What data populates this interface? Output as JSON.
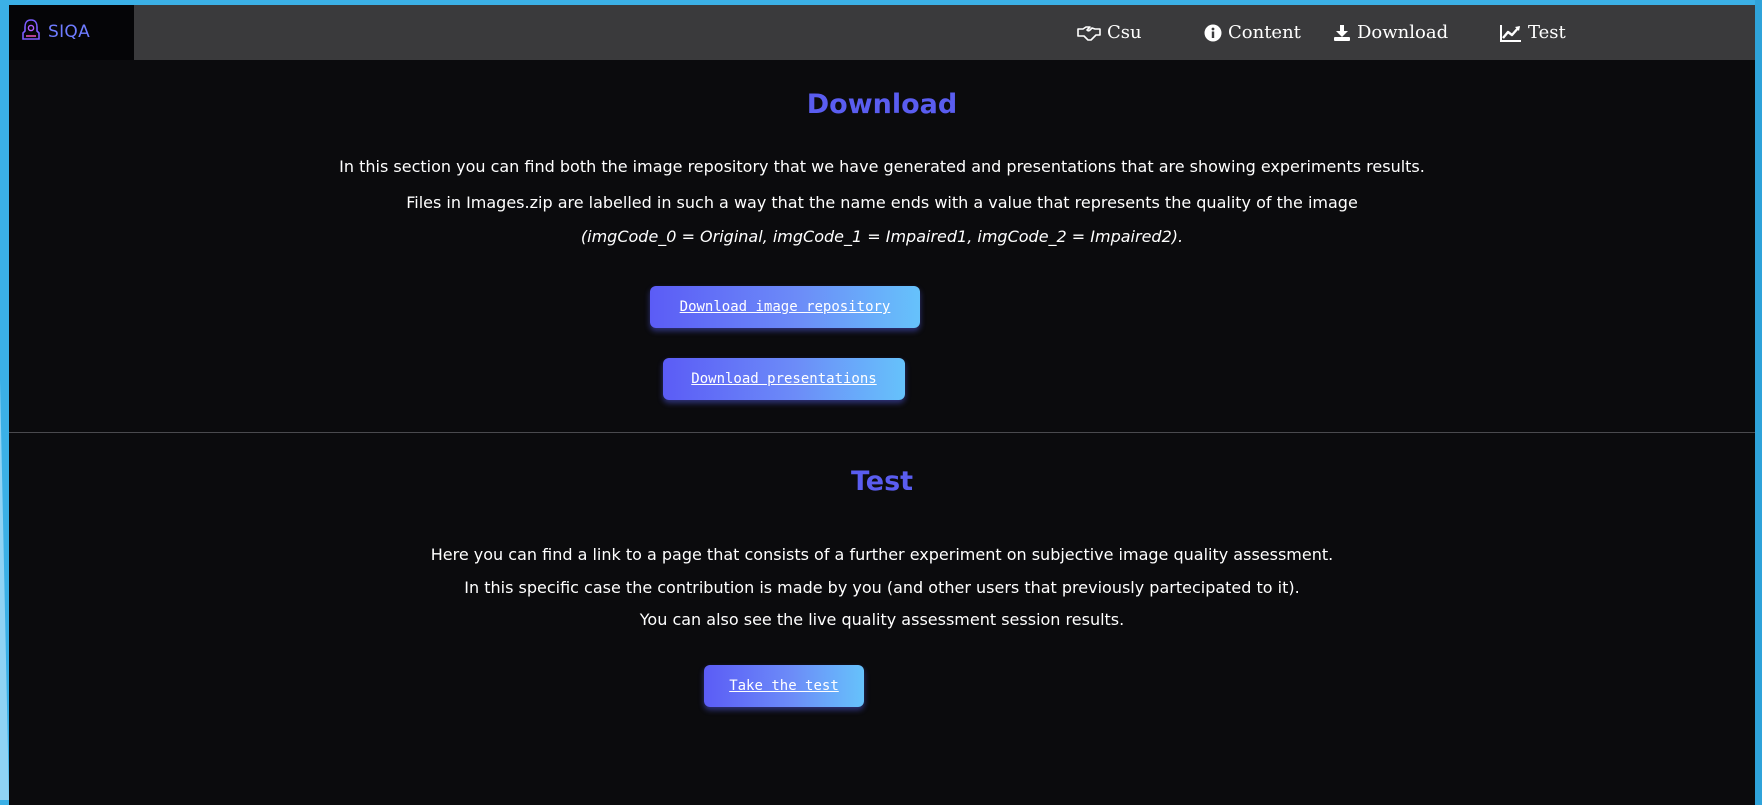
{
  "navbar": {
    "brand": "SIQA",
    "items": [
      {
        "label": "Csu",
        "icon": "handshake-icon"
      },
      {
        "label": "Content",
        "icon": "info-circle-icon"
      },
      {
        "label": "Download",
        "icon": "download-icon"
      },
      {
        "label": "Test",
        "icon": "line-chart-icon"
      }
    ]
  },
  "download_section": {
    "title": "Download",
    "paragraphs": [
      "In this section you can find both the image repository that we have generated and presentations that are showing experiments results.",
      "Files in Images.zip are labelled in such a way that the name ends with a value that represents the quality of the image",
      "(imgCode_0 = Original, imgCode_1 = Impaired1, imgCode_2 = Impaired2)."
    ],
    "buttons": {
      "repository": "Download image repository",
      "presentations": "Download presentations"
    }
  },
  "test_section": {
    "title": "Test",
    "paragraphs": [
      "Here you can find a link to a page that consists of a further experiment on subjective image quality assessment.",
      "In this specific case the contribution is made by you (and other users that previously partecipated to it).",
      "You can also see the live quality assessment session results."
    ],
    "button": "Take the test"
  },
  "colors": {
    "accent": "#5a5df0",
    "navbar_bg": "#3a3a3c",
    "page_bg": "#0b0b0d",
    "frame": "#3bb0e6"
  }
}
